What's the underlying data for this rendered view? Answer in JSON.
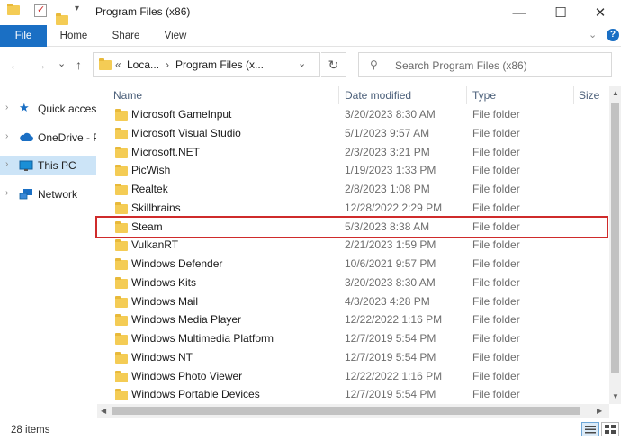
{
  "window": {
    "title": "Program Files (x86)",
    "minimize": "—",
    "maximize": "☐",
    "close": "✕"
  },
  "ribbon": {
    "tabs": [
      "File",
      "Home",
      "Share",
      "View"
    ],
    "collapse_icon": "chevron-down-icon",
    "help": "?"
  },
  "nav": {
    "back": "←",
    "forward": "→",
    "recent": "⌄",
    "up": "↑"
  },
  "address": {
    "overflow": "«",
    "segment1": "Loca...",
    "sep": "›",
    "segment2": "Program Files (x...",
    "dropdown": "⌄",
    "refresh": "↻"
  },
  "search": {
    "placeholder": "Search Program Files (x86)"
  },
  "sidebar": {
    "items": [
      {
        "label": "Quick access",
        "icon": "star-icon",
        "color": "#1a6fc4"
      },
      {
        "label": "OneDrive - P",
        "icon": "cloud-icon",
        "color": "#1a6fc4"
      },
      {
        "label": "This PC",
        "icon": "monitor-icon",
        "color": "#1a8fd6",
        "selected": true
      },
      {
        "label": "Network",
        "icon": "network-icon",
        "color": "#1a6fc4"
      }
    ]
  },
  "columns": {
    "name": "Name",
    "date": "Date modified",
    "type": "Type",
    "size": "Size"
  },
  "files": [
    {
      "name": "Microsoft GameInput",
      "date": "3/20/2023 8:30 AM",
      "type": "File folder"
    },
    {
      "name": "Microsoft Visual Studio",
      "date": "5/1/2023 9:57 AM",
      "type": "File folder"
    },
    {
      "name": "Microsoft.NET",
      "date": "2/3/2023 3:21 PM",
      "type": "File folder"
    },
    {
      "name": "PicWish",
      "date": "1/19/2023 1:33 PM",
      "type": "File folder"
    },
    {
      "name": "Realtek",
      "date": "2/8/2023 1:08 PM",
      "type": "File folder"
    },
    {
      "name": "Skillbrains",
      "date": "12/28/2022 2:29 PM",
      "type": "File folder"
    },
    {
      "name": "Steam",
      "date": "5/3/2023 8:38 AM",
      "type": "File folder",
      "highlighted": true
    },
    {
      "name": "VulkanRT",
      "date": "2/21/2023 1:59 PM",
      "type": "File folder"
    },
    {
      "name": "Windows Defender",
      "date": "10/6/2021 9:57 PM",
      "type": "File folder"
    },
    {
      "name": "Windows Kits",
      "date": "3/20/2023 8:30 AM",
      "type": "File folder"
    },
    {
      "name": "Windows Mail",
      "date": "4/3/2023 4:28 PM",
      "type": "File folder"
    },
    {
      "name": "Windows Media Player",
      "date": "12/22/2022 1:16 PM",
      "type": "File folder"
    },
    {
      "name": "Windows Multimedia Platform",
      "date": "12/7/2019 5:54 PM",
      "type": "File folder"
    },
    {
      "name": "Windows NT",
      "date": "12/7/2019 5:54 PM",
      "type": "File folder"
    },
    {
      "name": "Windows Photo Viewer",
      "date": "12/22/2022 1:16 PM",
      "type": "File folder"
    },
    {
      "name": "Windows Portable Devices",
      "date": "12/7/2019 5:54 PM",
      "type": "File folder"
    }
  ],
  "status": {
    "item_count": "28 items"
  },
  "colors": {
    "accent": "#1a6fc4",
    "folder": "#f4cc55",
    "highlight_border": "#cf2b2b",
    "selected_nav": "#cce4f7"
  }
}
